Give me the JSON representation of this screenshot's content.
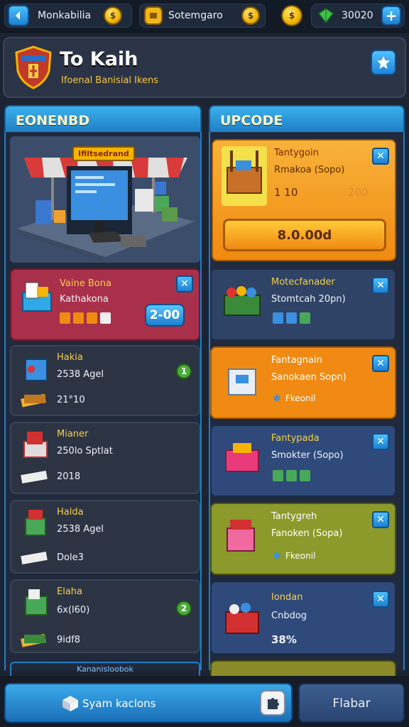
{
  "topbar": {
    "back_label": "Monkabilia",
    "currency_label": "Sotemgaro",
    "gems_value": "30020"
  },
  "header": {
    "title": "To Kaih",
    "subtitle": "Ifoenal Banisial Ikens"
  },
  "left_column": {
    "heading": "EONENBD",
    "shop_sign": "Ifiltsedrand",
    "featured": {
      "name": "Vaine Bona",
      "subname": "Kathakona",
      "price": "2-00"
    },
    "items": [
      {
        "name": "Hakia",
        "detail": "2538 Agel",
        "price": "21°10",
        "badge": "1"
      },
      {
        "name": "Mianer",
        "detail": "250lo Sptlat",
        "price": "2018",
        "badge": ""
      },
      {
        "name": "Halda",
        "detail": "2538 Agel",
        "price": "Dole3",
        "badge": ""
      },
      {
        "name": "Elaha",
        "detail": "6x(l60)",
        "price": "9idf8",
        "badge": "2"
      }
    ],
    "footer_link": "Kananisloobok"
  },
  "right_column": {
    "heading": "UPCODE",
    "featured": {
      "name": "Tantygoin",
      "detail": "Rmakoa (Sopo)",
      "value": "1 10",
      "ghost_value": "200",
      "buy_label": "8.0.00d"
    },
    "cards": [
      {
        "name": "Motecfanader",
        "detail": "Stomtcah 20pn)",
        "extra": "",
        "color": "#2f4366"
      },
      {
        "name": "Fantagnain",
        "detail": "Sanokaen Sopn)",
        "extra": "Fkeonil",
        "color": "#f08a12"
      },
      {
        "name": "Fantypada",
        "detail": "Smokter (Sopo)",
        "extra": "",
        "color": "#2f4a7a"
      },
      {
        "name": "Tantygreh",
        "detail": "Fanoken (Sopa)",
        "extra": "Fkeonil",
        "color": "#8b9a2a"
      },
      {
        "name": "Iondan",
        "detail": "Cnbdog",
        "extra": "38%",
        "color": "#2f4a7a"
      }
    ]
  },
  "bottom": {
    "primary_label": "Syam kaclons",
    "secondary_label": "Flabar"
  },
  "colors": {
    "accent_blue": "#2a8fd6",
    "gold": "#f4b400",
    "orange_card": "#f08a12",
    "red_card": "#a8304a"
  }
}
